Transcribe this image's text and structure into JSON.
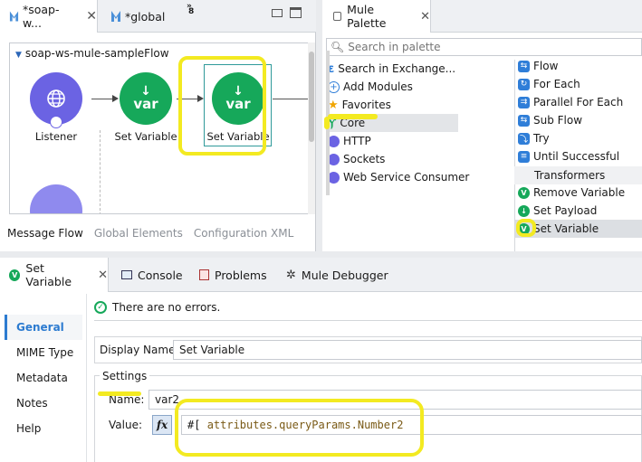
{
  "editor": {
    "tabs": [
      {
        "label": "*soap-w...",
        "close": "✕"
      },
      {
        "label": "*global"
      }
    ],
    "overflow_count": "8",
    "flow": {
      "title": "soap-ws-mule-sampleFlow",
      "nodes": [
        {
          "label": "Listener",
          "type": "listener"
        },
        {
          "label": "Set Variable",
          "type": "var",
          "icon_text": "var"
        },
        {
          "label": "Set Variable",
          "type": "var",
          "icon_text": "var"
        }
      ]
    },
    "bottom_tabs": [
      "Message Flow",
      "Global Elements",
      "Configuration XML"
    ]
  },
  "palette": {
    "tab_label": "Mule Palette",
    "close": "✕",
    "search_placeholder": "Search in palette",
    "left_items": [
      {
        "label": "Search in Exchange...",
        "icon": "exchange-icon"
      },
      {
        "label": "Add Modules",
        "icon": "plus-icon"
      },
      {
        "label": "Favorites",
        "icon": "star-icon"
      },
      {
        "label": "Core",
        "icon": "mule-core-icon"
      },
      {
        "label": "HTTP",
        "icon": "globe-icon"
      },
      {
        "label": "Sockets",
        "icon": "globe-icon"
      },
      {
        "label": "Web Service Consumer",
        "icon": "globe-icon"
      }
    ],
    "right_items": [
      {
        "label": "Flow",
        "icon": "flow-icon"
      },
      {
        "label": "For Each",
        "icon": "for-each-icon"
      },
      {
        "label": "Parallel For Each",
        "icon": "parallel-icon"
      },
      {
        "label": "Sub Flow",
        "icon": "sub-flow-icon"
      },
      {
        "label": "Try",
        "icon": "try-icon"
      },
      {
        "label": "Until Successful",
        "icon": "until-successful-icon"
      }
    ],
    "section_transformers": "Transformers",
    "transformer_items": [
      {
        "label": "Remove Variable"
      },
      {
        "label": "Set Payload"
      },
      {
        "label": "Set Variable"
      }
    ]
  },
  "properties": {
    "tabs": [
      {
        "label": "Set Variable",
        "close": "✕"
      },
      {
        "label": "Console"
      },
      {
        "label": "Problems"
      },
      {
        "label": "Mule Debugger"
      }
    ],
    "nav": [
      "General",
      "MIME Type",
      "Metadata",
      "Notes",
      "Help"
    ],
    "status": "There are no errors.",
    "display_name_label": "Display Name:",
    "display_name_value": "Set Variable",
    "settings_label": "Settings",
    "name_label": "Name:",
    "name_value": "var2",
    "value_label": "Value:",
    "fx_label": "fx",
    "value_prefix": "#[",
    "value_expression": "attributes.queryParams.Number2"
  },
  "colors": {
    "highlight": "#f3ea21",
    "mule_green": "#16a85a",
    "listener_purple": "#6b63e3",
    "accent_blue": "#2c7bd0"
  }
}
